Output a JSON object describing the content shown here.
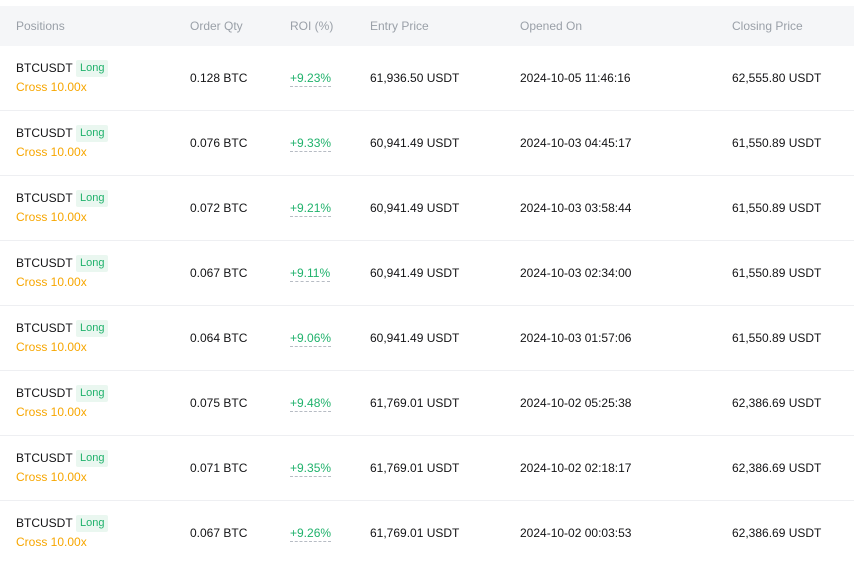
{
  "columns": {
    "positions": "Positions",
    "order_qty": "Order Qty",
    "roi": "ROI (%)",
    "entry_price": "Entry Price",
    "opened_on": "Opened On",
    "closing_price": "Closing Price"
  },
  "colors": {
    "long": "#20b26c",
    "margin": "#f7a600",
    "header_bg": "#f5f6f8"
  },
  "rows": [
    {
      "symbol": "BTCUSDT",
      "side": "Long",
      "margin": "Cross 10.00x",
      "qty": "0.128 BTC",
      "roi": "+9.23%",
      "entry": "61,936.50 USDT",
      "opened": "2024-10-05 11:46:16",
      "closing": "62,555.80 USDT"
    },
    {
      "symbol": "BTCUSDT",
      "side": "Long",
      "margin": "Cross 10.00x",
      "qty": "0.076 BTC",
      "roi": "+9.33%",
      "entry": "60,941.49 USDT",
      "opened": "2024-10-03 04:45:17",
      "closing": "61,550.89 USDT"
    },
    {
      "symbol": "BTCUSDT",
      "side": "Long",
      "margin": "Cross 10.00x",
      "qty": "0.072 BTC",
      "roi": "+9.21%",
      "entry": "60,941.49 USDT",
      "opened": "2024-10-03 03:58:44",
      "closing": "61,550.89 USDT"
    },
    {
      "symbol": "BTCUSDT",
      "side": "Long",
      "margin": "Cross 10.00x",
      "qty": "0.067 BTC",
      "roi": "+9.11%",
      "entry": "60,941.49 USDT",
      "opened": "2024-10-03 02:34:00",
      "closing": "61,550.89 USDT"
    },
    {
      "symbol": "BTCUSDT",
      "side": "Long",
      "margin": "Cross 10.00x",
      "qty": "0.064 BTC",
      "roi": "+9.06%",
      "entry": "60,941.49 USDT",
      "opened": "2024-10-03 01:57:06",
      "closing": "61,550.89 USDT"
    },
    {
      "symbol": "BTCUSDT",
      "side": "Long",
      "margin": "Cross 10.00x",
      "qty": "0.075 BTC",
      "roi": "+9.48%",
      "entry": "61,769.01 USDT",
      "opened": "2024-10-02 05:25:38",
      "closing": "62,386.69 USDT"
    },
    {
      "symbol": "BTCUSDT",
      "side": "Long",
      "margin": "Cross 10.00x",
      "qty": "0.071 BTC",
      "roi": "+9.35%",
      "entry": "61,769.01 USDT",
      "opened": "2024-10-02 02:18:17",
      "closing": "62,386.69 USDT"
    },
    {
      "symbol": "BTCUSDT",
      "side": "Long",
      "margin": "Cross 10.00x",
      "qty": "0.067 BTC",
      "roi": "+9.26%",
      "entry": "61,769.01 USDT",
      "opened": "2024-10-02 00:03:53",
      "closing": "62,386.69 USDT"
    }
  ]
}
